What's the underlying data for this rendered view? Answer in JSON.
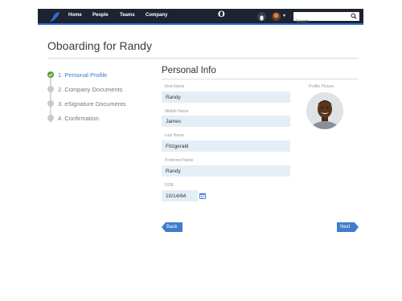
{
  "nav": {
    "items": [
      {
        "label": "Home"
      },
      {
        "label": "People"
      },
      {
        "label": "Teams"
      },
      {
        "label": "Company"
      }
    ],
    "brand_letter": "O",
    "search_placeholder": "Search",
    "logo_icon": "feather-logo-icon",
    "accent_color": "#2f6fd6"
  },
  "page": {
    "title": "Oboarding for Randy"
  },
  "steps": [
    {
      "label": "1. Personal Profile",
      "state": "complete"
    },
    {
      "label": "2. Company Documents",
      "state": "pending"
    },
    {
      "label": "3. eSignature Documents",
      "state": "pending"
    },
    {
      "label": "4. Confirmation",
      "state": "pending"
    }
  ],
  "form": {
    "section_title": "Personal Info",
    "profile_picture_label": "Profile Picture",
    "fields": {
      "first_name": {
        "label": "First Name",
        "value": "Randy"
      },
      "middle_name": {
        "label": "Middle Name",
        "value": "James"
      },
      "last_name": {
        "label": "Last Name",
        "value": "Fitzgerald"
      },
      "preferred_name": {
        "label": "Preferred Name",
        "value": "Randy"
      },
      "dob": {
        "label": "DOB",
        "value": "10/14/64"
      }
    }
  },
  "buttons": {
    "back": "Back",
    "next": "Next"
  }
}
